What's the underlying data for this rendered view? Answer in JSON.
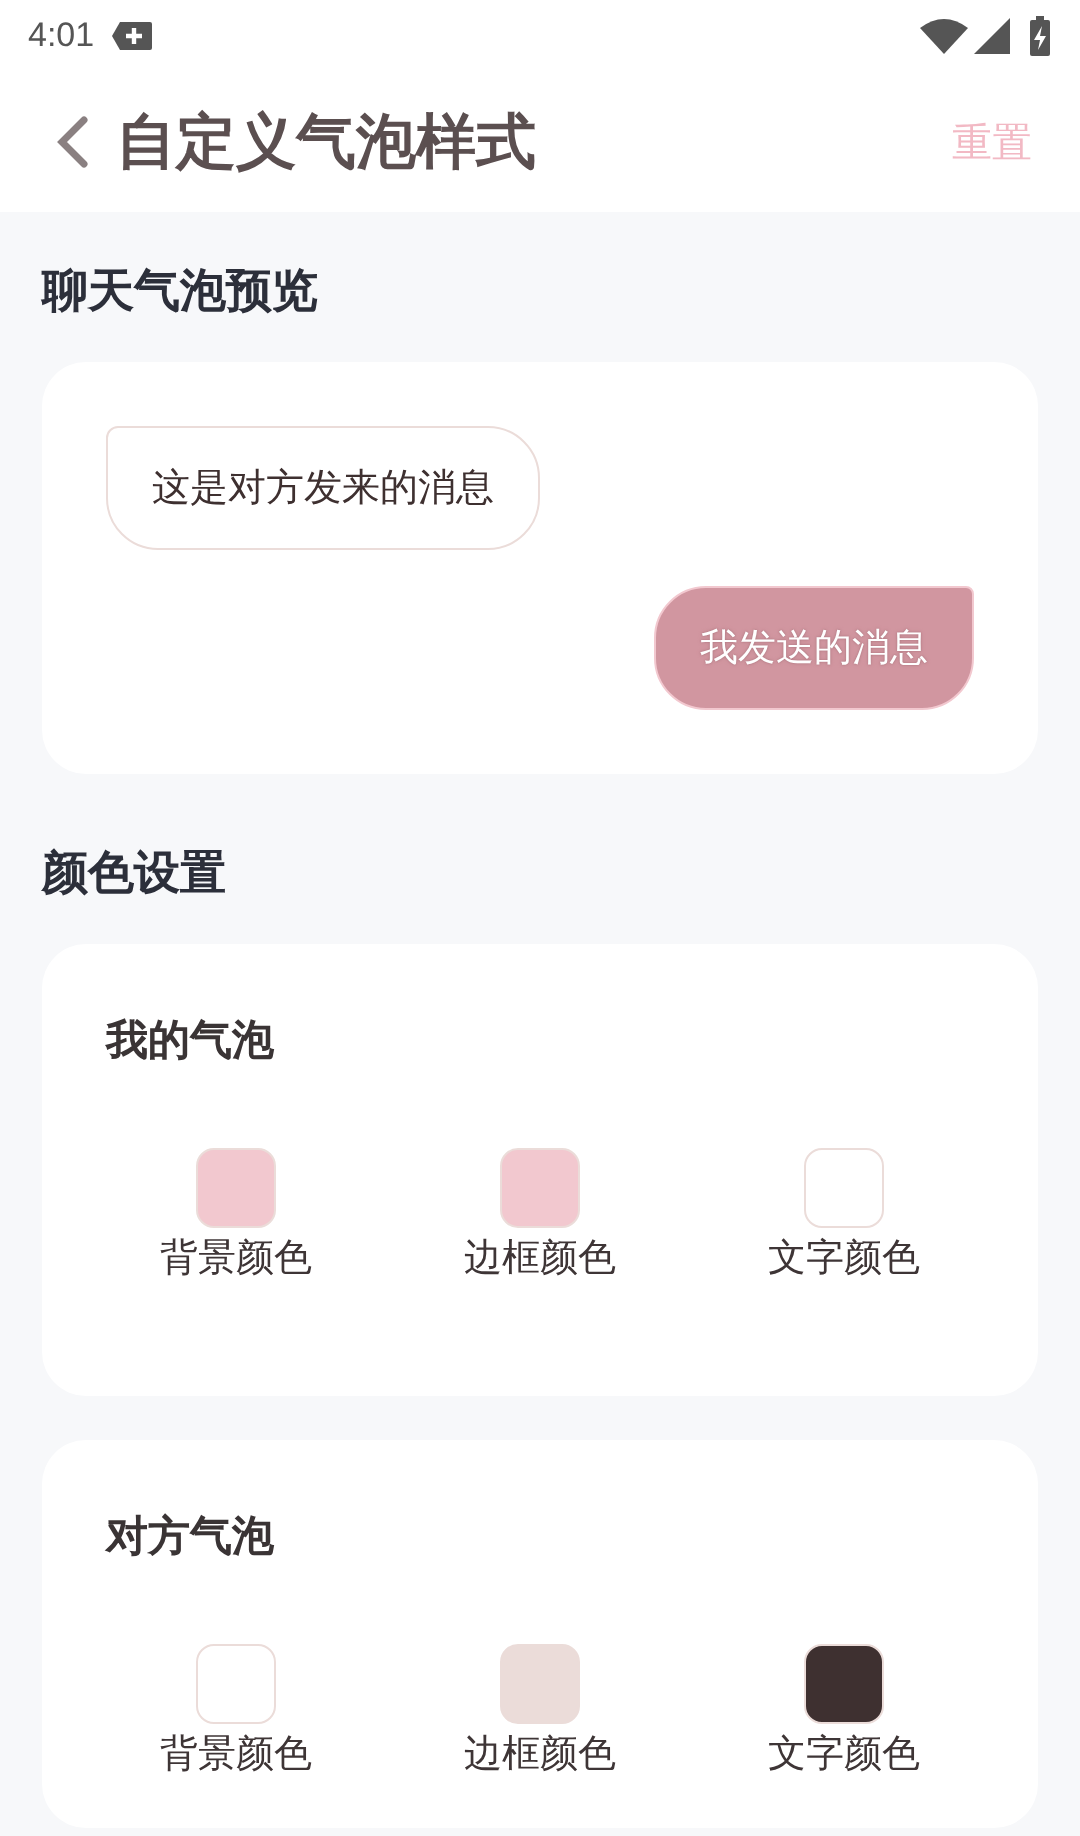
{
  "status_bar": {
    "time": "4:01"
  },
  "header": {
    "title": "自定义气泡样式",
    "action": "重置"
  },
  "preview": {
    "title": "聊天气泡预览",
    "messages": [
      {
        "kind": "incoming",
        "text": "这是对方发来的消息"
      },
      {
        "kind": "outgoing",
        "text": "我发送的消息"
      }
    ]
  },
  "color_settings": {
    "title": "颜色设置",
    "groups": [
      {
        "kind": "outgoing",
        "title": "我的气泡",
        "swatches": [
          {
            "label": "背景颜色",
            "color": "#f2c8cf"
          },
          {
            "label": "边框颜色",
            "color": "#f2c8cf"
          },
          {
            "label": "文字颜色",
            "color": "#ffffff"
          }
        ]
      },
      {
        "kind": "incoming",
        "title": "对方气泡",
        "swatches": [
          {
            "label": "背景颜色",
            "color": "#ffffff"
          },
          {
            "label": "边框颜色",
            "color": "#ebdcd9"
          },
          {
            "label": "文字颜色",
            "color": "#3e3030"
          }
        ]
      }
    ]
  }
}
